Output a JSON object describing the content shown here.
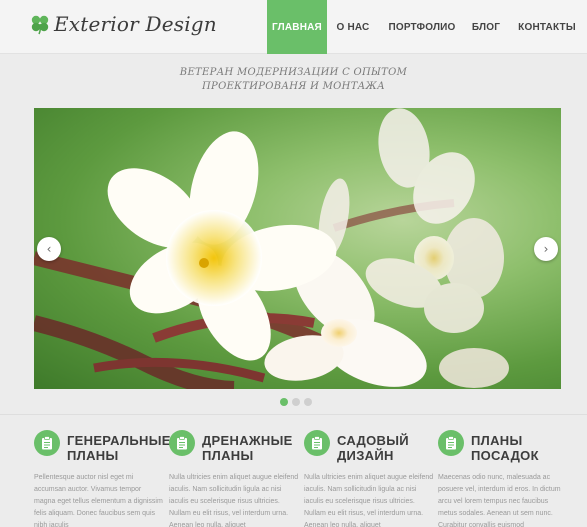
{
  "header": {
    "logo_text": "Exterior Design",
    "nav": [
      {
        "label": "ГЛАВНАЯ",
        "active": true
      },
      {
        "label": "О НАС",
        "active": false
      },
      {
        "label": "ПОРТФОЛИО",
        "active": false
      },
      {
        "label": "БЛОГ",
        "active": false
      },
      {
        "label": "КОНТАКТЫ",
        "active": false
      }
    ]
  },
  "tagline": {
    "line1": "ВЕТЕРАН МОДЕРНИЗАЦИИ С ОПЫТОМ",
    "line2": "ПРОЕКТИРОВАНЯ И МОНТАЖА"
  },
  "slider": {
    "prev_icon": "chevron-left-icon",
    "next_icon": "chevron-right-icon",
    "prev_glyph": "‹",
    "next_glyph": "›",
    "slide_count": 3,
    "active_slide": 1
  },
  "features": [
    {
      "icon": "clipboard-icon",
      "title_line1": "ГЕНЕРАЛЬНЫЕ",
      "title_line2": "ПЛАНЫ",
      "text": "Pellentesque auctor nisl eget mi accumsan auctor. Vivamus tempor magna eget tellus elementum a dignissim felis aliquam. Donec faucibus sem quis nibh iaculis"
    },
    {
      "icon": "clipboard-icon",
      "title_line1": "ДРЕНАЖНЫЕ",
      "title_line2": "ПЛАНЫ",
      "text": "Nulla ultricies enim aliquet augue eleifend iaculis. Nam sollicitudin ligula ac nisi iaculis eu scelerisque risus ultricies. Nullam eu elit risus, vel interdum urna. Aenean leo nulla, aliquet"
    },
    {
      "icon": "clipboard-icon",
      "title_line1": "САДОВЫЙ",
      "title_line2": "ДИЗАЙН",
      "text": "Nulla ultricies enim aliquet augue eleifend iaculis. Nam sollicitudin ligula ac nisi iaculis eu scelerisque risus ultricies. Nullam eu elit risus, vel interdum urna. Aenean leo nulla, aliquet"
    },
    {
      "icon": "clipboard-icon",
      "title_line1": "ПЛАНЫ",
      "title_line2": "ПОСАДОК",
      "text": "Maecenas odio nunc, malesuada ac posuere vel, interdum id eros. In dictum arcu vel lorem tempus nec faucibus metus sodales. Aenean ut sem nunc. Curabitur convallis euismod"
    }
  ],
  "colors": {
    "accent": "#6abf69",
    "background": "#ececec"
  }
}
